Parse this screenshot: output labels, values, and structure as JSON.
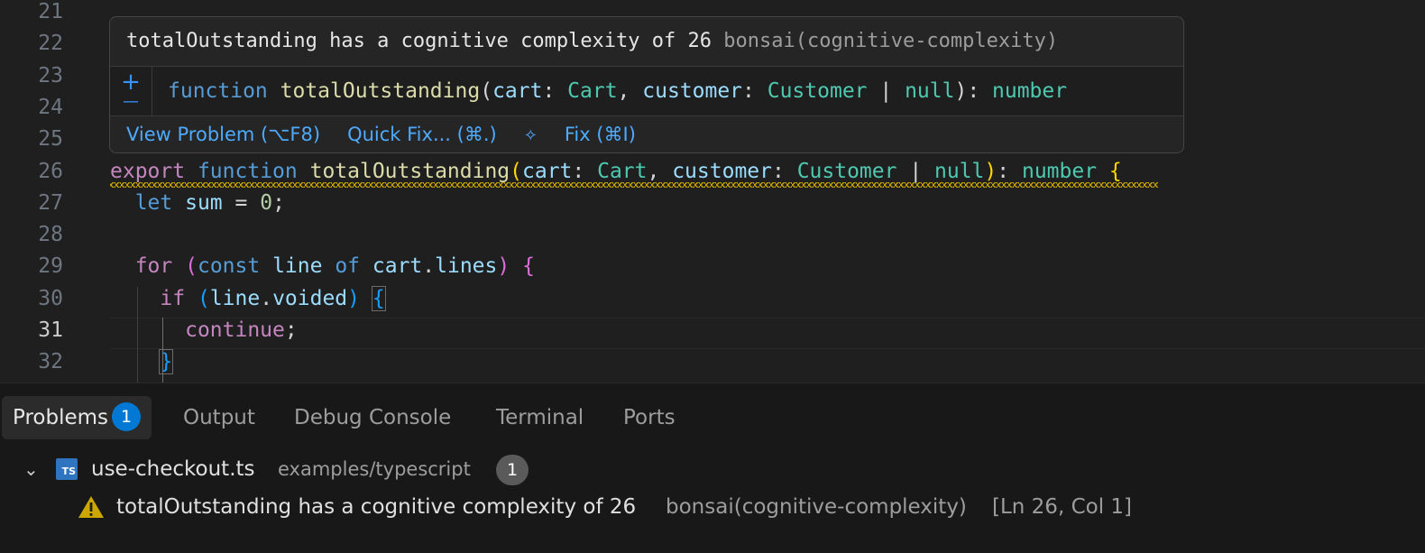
{
  "editor": {
    "lines": [
      {
        "num": "21"
      },
      {
        "num": "22"
      },
      {
        "num": "23"
      },
      {
        "num": "24"
      },
      {
        "num": "25"
      },
      {
        "num": "26",
        "tokens": [
          {
            "t": "export",
            "c": "kw"
          },
          {
            "t": " ",
            "c": "pl"
          },
          {
            "t": "function",
            "c": "kw2"
          },
          {
            "t": " ",
            "c": "pl"
          },
          {
            "t": "totalOutstanding",
            "c": "fn"
          },
          {
            "t": "(",
            "c": "br1"
          },
          {
            "t": "cart",
            "c": "var"
          },
          {
            "t": ": ",
            "c": "pl"
          },
          {
            "t": "Cart",
            "c": "ty"
          },
          {
            "t": ", ",
            "c": "pl"
          },
          {
            "t": "customer",
            "c": "var"
          },
          {
            "t": ": ",
            "c": "pl"
          },
          {
            "t": "Customer",
            "c": "ty"
          },
          {
            "t": " | ",
            "c": "pl"
          },
          {
            "t": "null",
            "c": "ty"
          },
          {
            "t": ")",
            "c": "br1"
          },
          {
            "t": ": ",
            "c": "pl"
          },
          {
            "t": "number",
            "c": "ty"
          },
          {
            "t": " ",
            "c": "pl"
          },
          {
            "t": "{",
            "c": "br1"
          }
        ]
      },
      {
        "num": "27",
        "tokens": [
          {
            "t": "  ",
            "c": "pl"
          },
          {
            "t": "let",
            "c": "kw2"
          },
          {
            "t": " ",
            "c": "pl"
          },
          {
            "t": "sum",
            "c": "var"
          },
          {
            "t": " = ",
            "c": "pl"
          },
          {
            "t": "0",
            "c": "num"
          },
          {
            "t": ";",
            "c": "pl"
          }
        ]
      },
      {
        "num": "28",
        "tokens": []
      },
      {
        "num": "29",
        "tokens": [
          {
            "t": "  ",
            "c": "pl"
          },
          {
            "t": "for",
            "c": "kw"
          },
          {
            "t": " ",
            "c": "pl"
          },
          {
            "t": "(",
            "c": "br2"
          },
          {
            "t": "const",
            "c": "kw2"
          },
          {
            "t": " ",
            "c": "pl"
          },
          {
            "t": "line",
            "c": "var"
          },
          {
            "t": " ",
            "c": "pl"
          },
          {
            "t": "of",
            "c": "kw2"
          },
          {
            "t": " ",
            "c": "pl"
          },
          {
            "t": "cart",
            "c": "var"
          },
          {
            "t": ".",
            "c": "pl"
          },
          {
            "t": "lines",
            "c": "var"
          },
          {
            "t": ")",
            "c": "br2"
          },
          {
            "t": " ",
            "c": "pl"
          },
          {
            "t": "{",
            "c": "br2"
          }
        ]
      },
      {
        "num": "30",
        "tokens": [
          {
            "t": "    ",
            "c": "pl"
          },
          {
            "t": "if",
            "c": "kw"
          },
          {
            "t": " ",
            "c": "pl"
          },
          {
            "t": "(",
            "c": "br3"
          },
          {
            "t": "line",
            "c": "var"
          },
          {
            "t": ".",
            "c": "pl"
          },
          {
            "t": "voided",
            "c": "var"
          },
          {
            "t": ")",
            "c": "br3"
          },
          {
            "t": " ",
            "c": "pl"
          },
          {
            "t": "{",
            "c": "br3 box"
          }
        ]
      },
      {
        "num": "31",
        "tokens": [
          {
            "t": "      ",
            "c": "pl"
          },
          {
            "t": "continue",
            "c": "kw"
          },
          {
            "t": ";",
            "c": "pl"
          }
        ]
      },
      {
        "num": "32",
        "tokens": [
          {
            "t": "    ",
            "c": "pl"
          },
          {
            "t": "}",
            "c": "br3 box"
          }
        ]
      }
    ],
    "active_line": "31"
  },
  "hover": {
    "message": "totalOutstanding has a cognitive complexity of 26",
    "source": "bonsai(cognitive-complexity)",
    "expand_glyph": "+",
    "collapse_glyph": "—",
    "signature": [
      {
        "t": "function",
        "c": "kw2"
      },
      {
        "t": " ",
        "c": "pl"
      },
      {
        "t": "totalOutstanding",
        "c": "fn"
      },
      {
        "t": "(",
        "c": "pl"
      },
      {
        "t": "cart",
        "c": "var"
      },
      {
        "t": ": ",
        "c": "pl"
      },
      {
        "t": "Cart",
        "c": "ty"
      },
      {
        "t": ", ",
        "c": "pl"
      },
      {
        "t": "customer",
        "c": "var"
      },
      {
        "t": ": ",
        "c": "pl"
      },
      {
        "t": "Customer",
        "c": "ty"
      },
      {
        "t": " | ",
        "c": "pl"
      },
      {
        "t": "null",
        "c": "ty"
      },
      {
        "t": ")",
        "c": "pl"
      },
      {
        "t": ": ",
        "c": "pl"
      },
      {
        "t": "number",
        "c": "ty"
      }
    ],
    "actions": {
      "view_problem": "View Problem (⌥F8)",
      "quick_fix": "Quick Fix... (⌘.)",
      "fix_glyph": "✧",
      "fix": "Fix (⌘I)"
    }
  },
  "panel": {
    "tabs": {
      "problems": "Problems",
      "problems_badge": "1",
      "output": "Output",
      "debug_console": "Debug Console",
      "terminal": "Terminal",
      "ports": "Ports"
    },
    "file": {
      "chevron": "⌄",
      "icon_text": "TS",
      "name": "use-checkout.ts",
      "path": "examples/typescript",
      "count": "1"
    },
    "problem": {
      "message": "totalOutstanding has a cognitive complexity of 26",
      "source": "bonsai(cognitive-complexity)",
      "location": "[Ln 26, Col 1]"
    }
  },
  "colors": {
    "accent": "#0078d4",
    "link": "#4daafc",
    "warning": "#cca700"
  }
}
